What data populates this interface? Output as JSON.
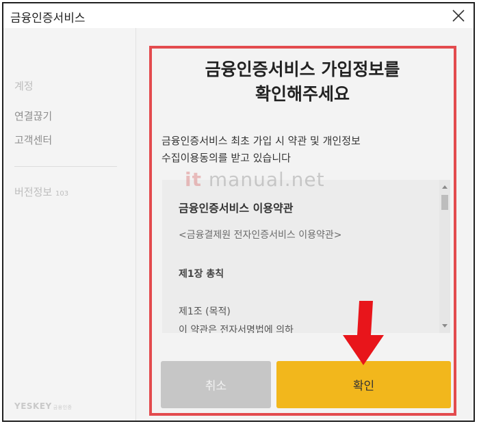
{
  "window": {
    "title": "금융인증서비스"
  },
  "sidebar": {
    "items": [
      {
        "label": "계정"
      },
      {
        "label": "연결끊기"
      },
      {
        "label": "고객센터"
      }
    ],
    "version_label": "버전정보",
    "version_number": "103",
    "brand": "YESKEY",
    "brand_sub": "금융인증"
  },
  "main": {
    "heading_line1": "금융인증서비스 가입정보를",
    "heading_line2": "확인해주세요",
    "desc_line1": "금융인증서비스 최초 가입 시 약관 및 개인정보",
    "desc_line2": "수집이용동의를 받고 있습니다"
  },
  "terms": {
    "title": "금융인증서비스 이용약관",
    "subtitle": "<금융결제원 전자인증서비스 이용약관>",
    "chapter": "제1장 총칙",
    "article": "제1조 (목적)",
    "body": "이 약관은 전자서명법에 의하"
  },
  "watermark": {
    "prefix": "it",
    "text": "manual.net"
  },
  "buttons": {
    "cancel": "취소",
    "confirm": "확인"
  },
  "colors": {
    "accent": "#f2b71c",
    "highlight": "#e34b4e",
    "arrow": "#e8151b"
  }
}
